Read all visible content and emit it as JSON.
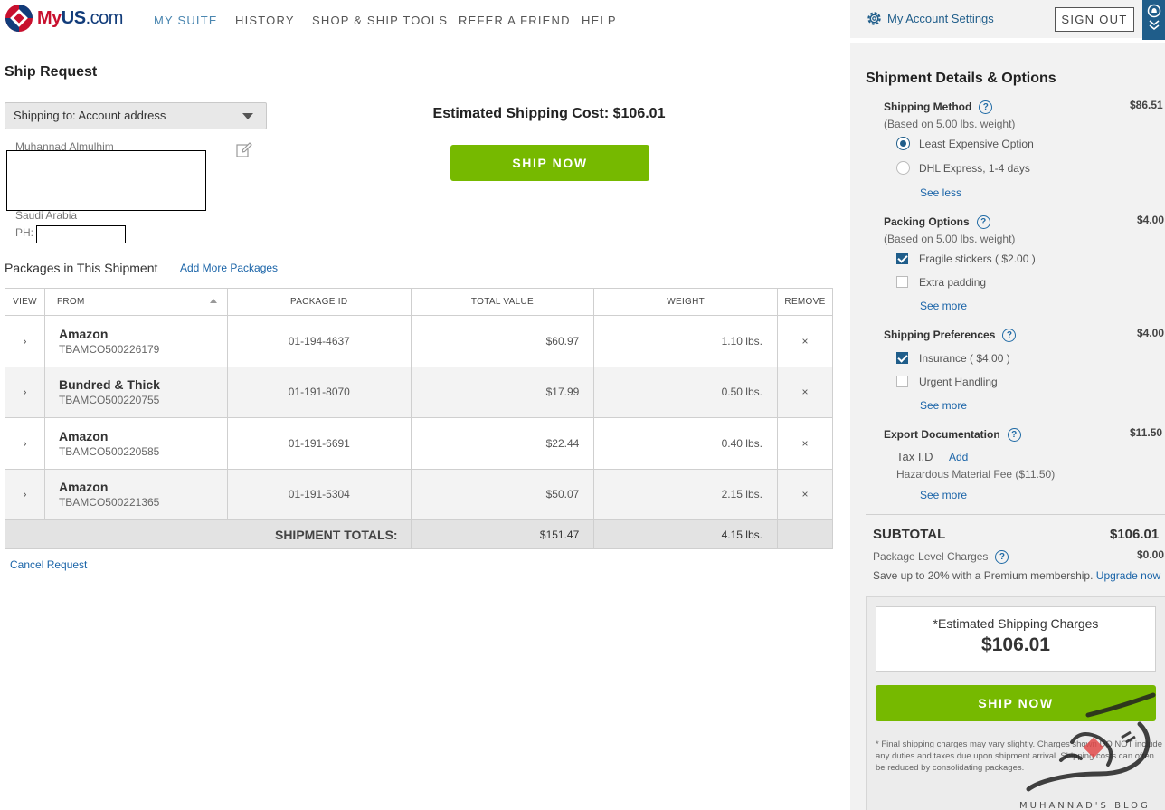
{
  "header": {
    "logo": {
      "my": "My",
      "us": "US",
      "com": ".com"
    },
    "nav": [
      {
        "label": "MY SUITE",
        "active": true
      },
      {
        "label": "HISTORY",
        "active": false
      },
      {
        "label": "SHOP & SHIP TOOLS",
        "active": false
      },
      {
        "label": "REFER A FRIEND",
        "active": false
      },
      {
        "label": "HELP",
        "active": false
      }
    ],
    "account_settings": "My Account Settings",
    "sign_out": "SIGN OUT"
  },
  "ship_request": {
    "title": "Ship Request",
    "shipping_to": "Shipping to: Account address",
    "name": "Muhannad Almulhim",
    "country": "Saudi Arabia",
    "phone_label": "PH:",
    "estimated_cost": "Estimated Shipping Cost: $106.01",
    "ship_now": "SHIP NOW"
  },
  "packages": {
    "title": "Packages in This Shipment",
    "add_more": "Add More Packages",
    "columns": [
      "VIEW",
      "FROM",
      "PACKAGE ID",
      "TOTAL VALUE",
      "WEIGHT",
      "REMOVE"
    ],
    "rows": [
      {
        "from": "Amazon",
        "tracking": "TBAMCO500226179",
        "package_id": "01-194-4637",
        "value": "$60.97",
        "weight": "1.10 lbs."
      },
      {
        "from": "Bundred & Thick",
        "tracking": "TBAMCO500220755",
        "package_id": "01-191-8070",
        "value": "$17.99",
        "weight": "0.50 lbs."
      },
      {
        "from": "Amazon",
        "tracking": "TBAMCO500220585",
        "package_id": "01-191-6691",
        "value": "$22.44",
        "weight": "0.40 lbs."
      },
      {
        "from": "Amazon",
        "tracking": "TBAMCO500221365",
        "package_id": "01-191-5304",
        "value": "$50.07",
        "weight": "2.15 lbs."
      }
    ],
    "totals_label": "SHIPMENT TOTALS:",
    "total_value": "$151.47",
    "total_weight": "4.15 lbs.",
    "cancel": "Cancel Request"
  },
  "details": {
    "title": "Shipment Details & Options",
    "shipping_method": {
      "label": "Shipping Method",
      "sub": "(Based on 5.00 lbs. weight)",
      "price": "$86.51",
      "options": [
        "Least Expensive Option",
        "DHL Express, 1-4 days"
      ],
      "see": "See less"
    },
    "packing": {
      "label": "Packing Options",
      "sub": "(Based on 5.00 lbs. weight)",
      "price": "$4.00",
      "options": [
        "Fragile stickers ( $2.00 )",
        "Extra padding"
      ],
      "see": "See more"
    },
    "preferences": {
      "label": "Shipping Preferences",
      "price": "$4.00",
      "options": [
        "Insurance ( $4.00 )",
        "Urgent Handling"
      ],
      "see": "See more"
    },
    "export": {
      "label": "Export Documentation",
      "price": "$11.50",
      "tax_id": "Tax I.D",
      "add": "Add",
      "hazmat": "Hazardous Material Fee ($11.50)",
      "see": "See more"
    },
    "subtotal_label": "SUBTOTAL",
    "subtotal": "$106.01",
    "package_level_label": "Package Level Charges",
    "package_level": "$0.00",
    "premium": "Save up to 20% with a Premium membership.",
    "upgrade": "Upgrade now",
    "est_charges_label": "*Estimated Shipping Charges",
    "est_charges": "$106.01",
    "ship_now": "SHIP NOW",
    "fine_print": "* Final shipping charges may vary slightly. Charges shown DO NOT include any duties and taxes due upon shipment arrival. Shipping costs can often be reduced by consolidating packages."
  },
  "colors": {
    "accent": "#76b900",
    "brand_blue": "#1f5d8a",
    "link": "#1a64a8"
  }
}
